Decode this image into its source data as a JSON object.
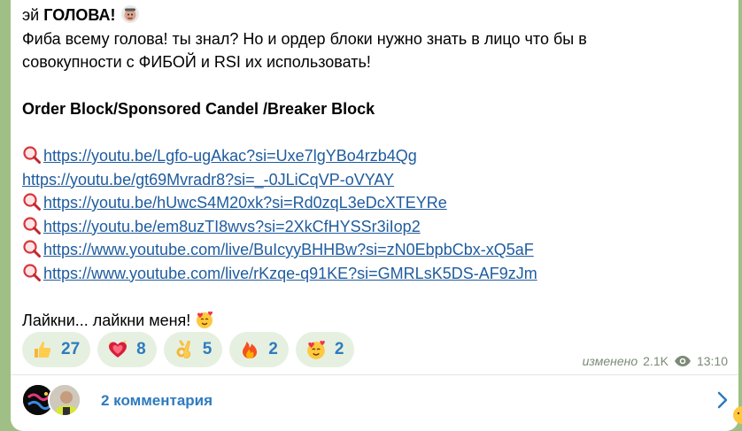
{
  "message": {
    "greeting": "эй ",
    "greeting_bold": "ГОЛОВА!",
    "line2": "Фиба всему голова! ты знал? Но и ордер блоки нужно знать в лицо что бы в",
    "line3": "совокупности с ФИБОЙ и RSI их использовать!",
    "heading": "Order Block/Sponsored Candel /Breaker Block",
    "links": [
      "https://youtu.be/Lgfo-ugAkac?si=Uxe7lgYBo4rzb4Qg",
      "https://youtu.be/gt69Mvradr8?si=_-0JLiCqVP-oVYAY",
      "https://youtu.be/hUwcS4M20xk?si=Rd0zqL3eDcXTEYRe",
      "https://youtu.be/em8uzTI8wvs?si=2XkCfHYSSr3iIop2",
      "https://www.youtube.com/live/BuIcyyBHHBw?si=zN0EbpbCbx-xQ5aF",
      "https://www.youtube.com/live/rKzqe-q91KE?si=GMRLsK5DS-AF9zJm"
    ],
    "closing": "Лайкни... лайкни меня!"
  },
  "reactions": [
    {
      "emoji": "thumbs-up",
      "count": "27"
    },
    {
      "emoji": "sparkling-heart",
      "count": "8"
    },
    {
      "emoji": "ok-hand",
      "count": "5"
    },
    {
      "emoji": "fire",
      "count": "2"
    },
    {
      "emoji": "smiling-face-with-hearts",
      "count": "2"
    }
  ],
  "meta": {
    "edited": "изменено",
    "views": "2.1K",
    "time": "13:10"
  },
  "comments": {
    "label": "2 комментария"
  },
  "colors": {
    "background": "#9fbf86",
    "bubble": "#ffffff",
    "link": "#1f5c9e",
    "accent": "#2e7bbf",
    "reaction_bg": "#e6f0e0",
    "meta": "#7b8a77"
  }
}
